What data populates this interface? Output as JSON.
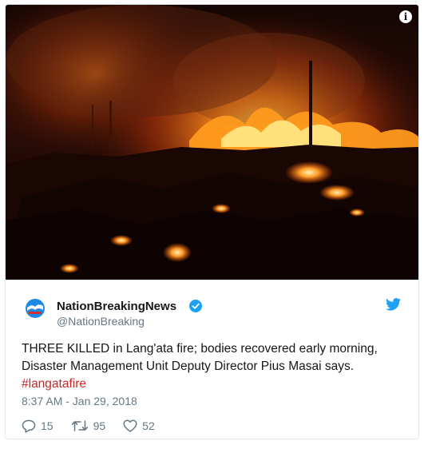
{
  "media": {
    "info_icon": "info-icon",
    "info_glyph": "i"
  },
  "tweet": {
    "display_name": "NationBreakingNews",
    "handle": "@NationBreaking",
    "text_line_1": "THREE KILLED in Lang'ata fire; bodies recovered early morning,",
    "text_line_2": "Disaster Management Unit Deputy Director Pius Masai says.",
    "hashtag": "#langatafire",
    "timestamp": "8:37 AM - Jan 29, 2018",
    "replies": "15",
    "retweets": "95",
    "likes": "52"
  },
  "icons": {
    "verified": "verified-badge-icon",
    "platform": "twitter-bird-icon",
    "reply": "reply-icon",
    "retweet": "retweet-icon",
    "like": "heart-icon"
  },
  "colors": {
    "hashtag": "#c62828",
    "verified": "#1da1f2",
    "secondary_text": "#657786",
    "border": "#e1e8ed"
  }
}
